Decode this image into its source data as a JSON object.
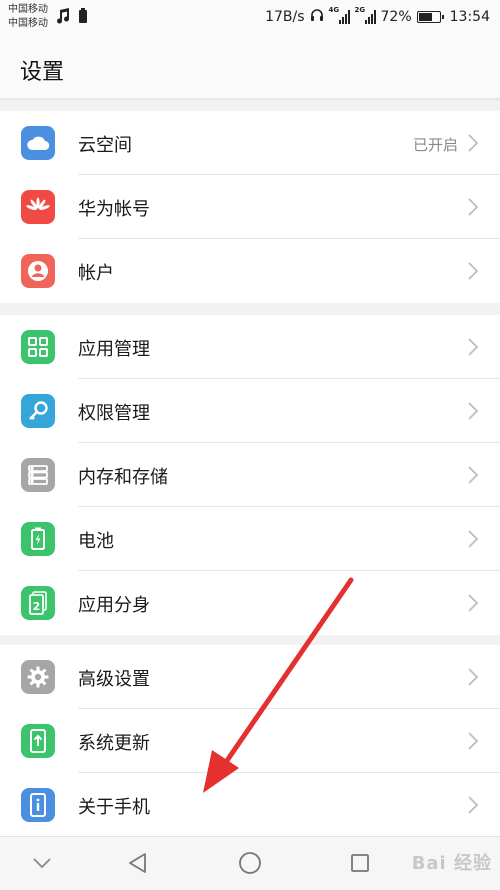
{
  "status_bar": {
    "carrier1": "中国移动",
    "carrier2": "中国移动",
    "speed": "17B/s",
    "sim1_type": "4G",
    "sim2_type": "2G",
    "battery_pct": "72%",
    "battery_level": 0.72,
    "time": "13:54"
  },
  "header": {
    "title": "设置"
  },
  "groups": [
    {
      "items": [
        {
          "label": "云空间",
          "status": "已开启",
          "icon": "cloud-icon",
          "color": "#4a8fe0"
        },
        {
          "label": "华为帐号",
          "icon": "huawei-logo-icon",
          "color": "#ef4b44"
        },
        {
          "label": "帐户",
          "icon": "user-icon",
          "color": "#f0645a"
        }
      ]
    },
    {
      "items": [
        {
          "label": "应用管理",
          "icon": "apps-grid-icon",
          "color": "#3cc46c"
        },
        {
          "label": "权限管理",
          "icon": "key-icon",
          "color": "#35a5da"
        },
        {
          "label": "内存和存储",
          "icon": "storage-icon",
          "color": "#a6a6a6"
        },
        {
          "label": "电池",
          "icon": "battery-icon",
          "color": "#3cc46c"
        },
        {
          "label": "应用分身",
          "icon": "app-twin-icon",
          "color": "#3cc46c"
        }
      ]
    },
    {
      "items": [
        {
          "label": "高级设置",
          "icon": "gear-icon",
          "color": "#a6a6a6"
        },
        {
          "label": "系统更新",
          "icon": "system-update-icon",
          "color": "#3cc46c"
        },
        {
          "label": "关于手机",
          "icon": "info-icon",
          "color": "#4a8fe0"
        }
      ]
    }
  ],
  "watermark": "Bai 经验"
}
